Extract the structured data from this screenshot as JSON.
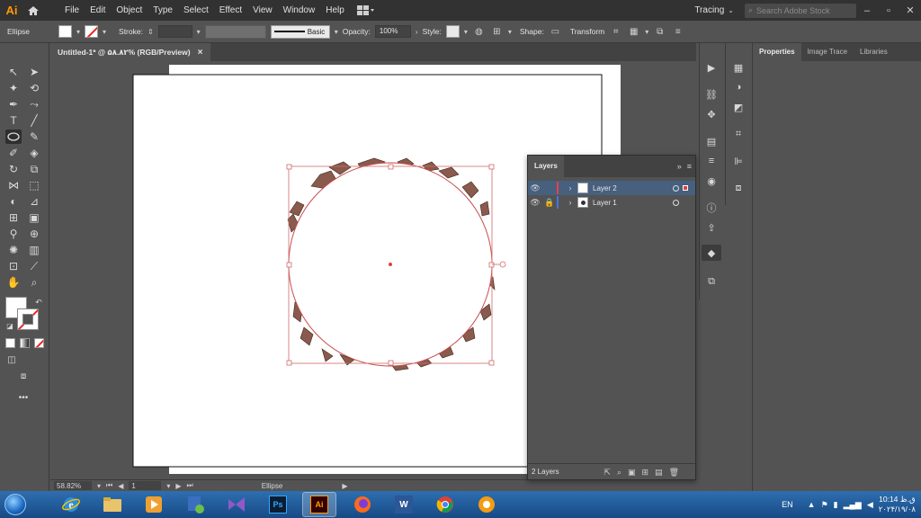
{
  "menubar": {
    "app_logo": "Ai",
    "items": [
      "File",
      "Edit",
      "Object",
      "Type",
      "Select",
      "Effect",
      "View",
      "Window",
      "Help"
    ],
    "workspace": "Tracing",
    "search_placeholder": "Search Adobe Stock"
  },
  "controlbar": {
    "object_type": "Ellipse",
    "stroke_label": "Stroke:",
    "brush_label": "Basic",
    "opacity_label": "Opacity:",
    "opacity_value": "100%",
    "style_label": "Style:",
    "shape_label": "Shape:",
    "transform_label": "Transform"
  },
  "document": {
    "tab_title": "Untitled-1* @ ۵۸.۸۲% (RGB/Preview)",
    "close_glyph": "×"
  },
  "status": {
    "zoom": "58.82%",
    "artboard": "1",
    "selection_tool": "Ellipse"
  },
  "properties_panel": {
    "tabs": [
      "Properties",
      "Image Trace",
      "Libraries"
    ]
  },
  "layers_panel": {
    "title": "Layers",
    "layers": [
      {
        "name": "Layer 2",
        "color": "#e8414b",
        "selected": true,
        "locked": false
      },
      {
        "name": "Layer 1",
        "color": "#4a74d8",
        "selected": false,
        "locked": true
      }
    ],
    "count": "2 Layers"
  },
  "taskbar": {
    "language": "EN",
    "time": "10:14 ق.ظ",
    "date": "۲۰۲۴/۱۹/۰۸"
  },
  "colors": {
    "app_bg": "#535353",
    "menubar_bg": "#323232",
    "accent_ai": "#ff9a00",
    "selection_red": "#e04040",
    "layer_selected_bg": "#46607e"
  }
}
